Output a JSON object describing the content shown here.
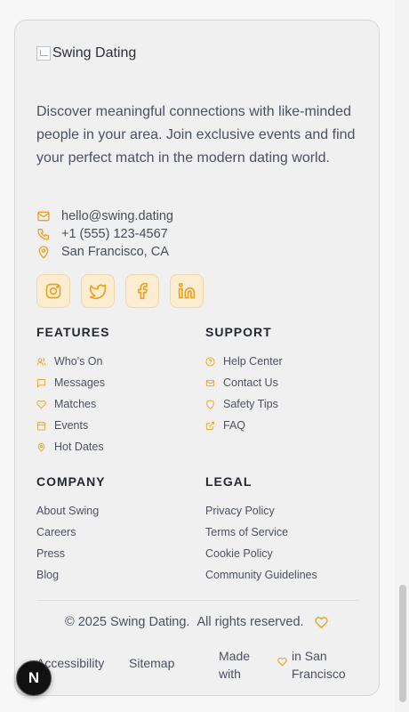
{
  "logo": {
    "alt": "Swing Dating"
  },
  "description": "Discover meaningful connections with like-minded people in your area. Join exclusive events and find your perfect match in the modern dating world.",
  "contact": {
    "email": "hello@swing.dating",
    "phone": "+1 (555) 123-4567",
    "location": "San Francisco, CA"
  },
  "socials": [
    {
      "icon": "instagram-icon"
    },
    {
      "icon": "twitter-icon"
    },
    {
      "icon": "facebook-icon"
    },
    {
      "icon": "linkedin-icon"
    }
  ],
  "features": {
    "heading": "FEATURES",
    "items": [
      "Who's On",
      "Messages",
      "Matches",
      "Events",
      "Hot Dates"
    ]
  },
  "support": {
    "heading": "SUPPORT",
    "items": [
      "Help Center",
      "Contact Us",
      "Safety Tips",
      "FAQ"
    ]
  },
  "company": {
    "heading": "COMPANY",
    "items": [
      "About Swing",
      "Careers",
      "Press",
      "Blog"
    ]
  },
  "legal": {
    "heading": "LEGAL",
    "items": [
      "Privacy Policy",
      "Terms of Service",
      "Cookie Policy",
      "Community Guidelines"
    ]
  },
  "footer": {
    "copyright": "© 2025 Swing Dating.",
    "rights": "All rights reserved.",
    "links": [
      "Accessibility",
      "Sitemap"
    ],
    "made_with": "Made with",
    "made_in": "in San Francisco"
  },
  "fab": {
    "label": "N"
  },
  "colors": {
    "accent": "#e8a322",
    "accent_bg": "#fbecd2"
  }
}
